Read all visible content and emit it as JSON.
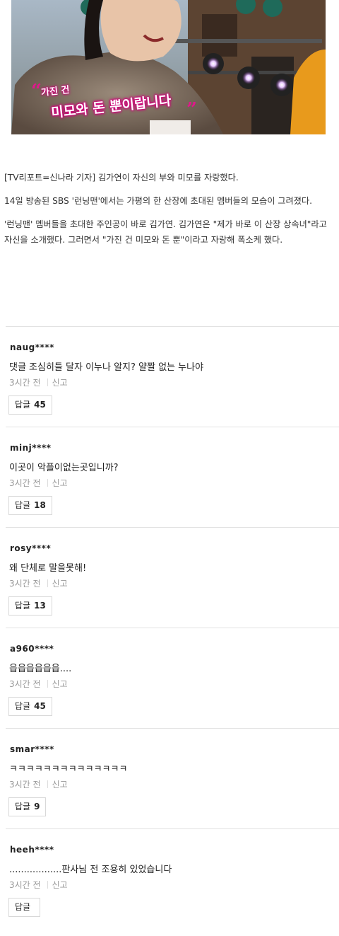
{
  "photo": {
    "caption_line1": "가진 건",
    "caption_line2": "미모와 돈 뿐이랍니다",
    "caption_color": "#e0188b"
  },
  "article": {
    "paragraphs": [
      "[TV리포트=신나라 기자] 김가연이 자신의 부와 미모를 자랑했다.",
      "14일 방송된 SBS '런닝맨'에서는 가평의 한 산장에 초대된 멤버들의 모습이 그려졌다.",
      "'런닝맨' 멤버들을 초대한 주인공이 바로 김가연. 김가연은 \"제가 바로 이 산장 상속녀\"라고 자신을 소개했다. 그러면서 \"가진 건 미모와 돈 뿐\"이라고 자랑해 폭소케 했다."
    ]
  },
  "comments": [
    {
      "user": "naug****",
      "text": "댓글 조심히들 달자 이누나 알지? 얄짤 없는 누나야",
      "time": "3시간 전",
      "report": "신고",
      "reply_label": "답글",
      "reply_count": "45"
    },
    {
      "user": "minj****",
      "text": "이곳이 악플이없는곳입니까?",
      "time": "3시간 전",
      "report": "신고",
      "reply_label": "답글",
      "reply_count": "18"
    },
    {
      "user": "rosy****",
      "text": "왜 단체로 말을못해!",
      "time": "3시간 전",
      "report": "신고",
      "reply_label": "답글",
      "reply_count": "13"
    },
    {
      "user": "a960****",
      "text": "읍읍읍읍읍읍....",
      "time": "3시간 전",
      "report": "신고",
      "reply_label": "답글",
      "reply_count": "45"
    },
    {
      "user": "smar****",
      "text": "ㅋㅋㅋㅋㅋㅋㅋㅋㅋㅋㅋㅋㅋㅋ",
      "time": "3시간 전",
      "report": "신고",
      "reply_label": "답글",
      "reply_count": "9"
    },
    {
      "user": "heeh****",
      "text": "..................판사님 전 조용히 있었습니다",
      "time": "3시간 전",
      "report": "신고",
      "reply_label": "답글",
      "reply_count": ""
    }
  ]
}
